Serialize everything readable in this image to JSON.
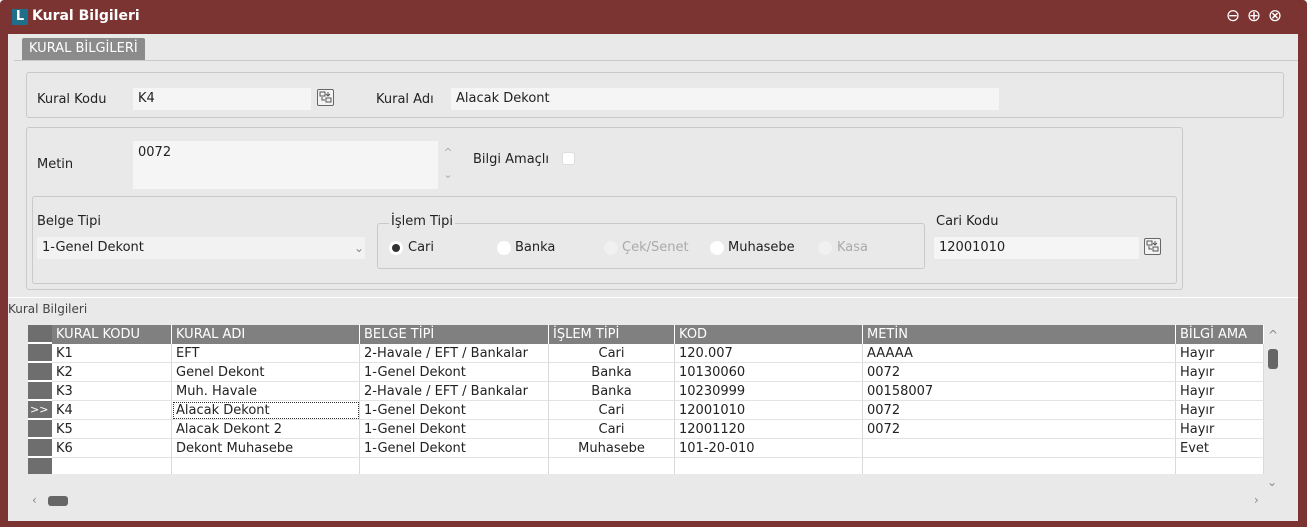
{
  "window": {
    "title": "Kural Bilgileri",
    "logo_letter": "L",
    "accent_color": "#7b3431"
  },
  "tab": {
    "label": "KURAL BİLGİLERİ"
  },
  "form": {
    "rule_code_label": "Kural Kodu",
    "rule_code_value": "K4",
    "rule_name_label": "Kural Adı",
    "rule_name_value": "Alacak Dekont",
    "text_label": "Metin",
    "text_value": "0072",
    "info_label": "Bilgi Amaçlı",
    "info_checked": false,
    "doc_type_label": "Belge Tipi",
    "doc_type_value": "1-Genel Dekont",
    "op_type_legend": "İşlem Tipi",
    "op_options": [
      {
        "label": "Cari",
        "selected": true,
        "enabled": true
      },
      {
        "label": "Banka",
        "selected": false,
        "enabled": true
      },
      {
        "label": "Çek/Senet",
        "selected": false,
        "enabled": false
      },
      {
        "label": "Muhasebe",
        "selected": false,
        "enabled": true
      },
      {
        "label": "Kasa",
        "selected": false,
        "enabled": false
      }
    ],
    "account_code_label": "Cari Kodu",
    "account_code_value": "12001010"
  },
  "grid": {
    "title": "Kural Bilgileri",
    "columns": [
      "KURAL KODU",
      "KURAL ADI",
      "BELGE TİPİ",
      "İŞLEM TİPİ",
      "KOD",
      "METİN",
      "BİLGİ AMA"
    ],
    "current_row_marker": ">>",
    "rows": [
      [
        "K1",
        "EFT",
        "2-Havale / EFT / Bankalar",
        "Cari",
        "120.007",
        "AAAAA",
        "Hayır"
      ],
      [
        "K2",
        "Genel Dekont",
        "1-Genel Dekont",
        "Banka",
        "10130060",
        "0072",
        "Hayır"
      ],
      [
        "K3",
        "Muh. Havale",
        "2-Havale / EFT / Bankalar",
        "Banka",
        "10230999",
        "00158007",
        "Hayır"
      ],
      [
        "K4",
        "Alacak Dekont",
        "1-Genel Dekont",
        "Cari",
        "12001010",
        "0072",
        "Hayır"
      ],
      [
        "K5",
        "Alacak Dekont 2",
        "1-Genel Dekont",
        "Cari",
        "12001120",
        "0072",
        "Hayır"
      ],
      [
        "K6",
        "Dekont Muhasebe",
        "1-Genel Dekont",
        "Muhasebe",
        "101-20-010",
        "",
        "Evet"
      ]
    ]
  }
}
